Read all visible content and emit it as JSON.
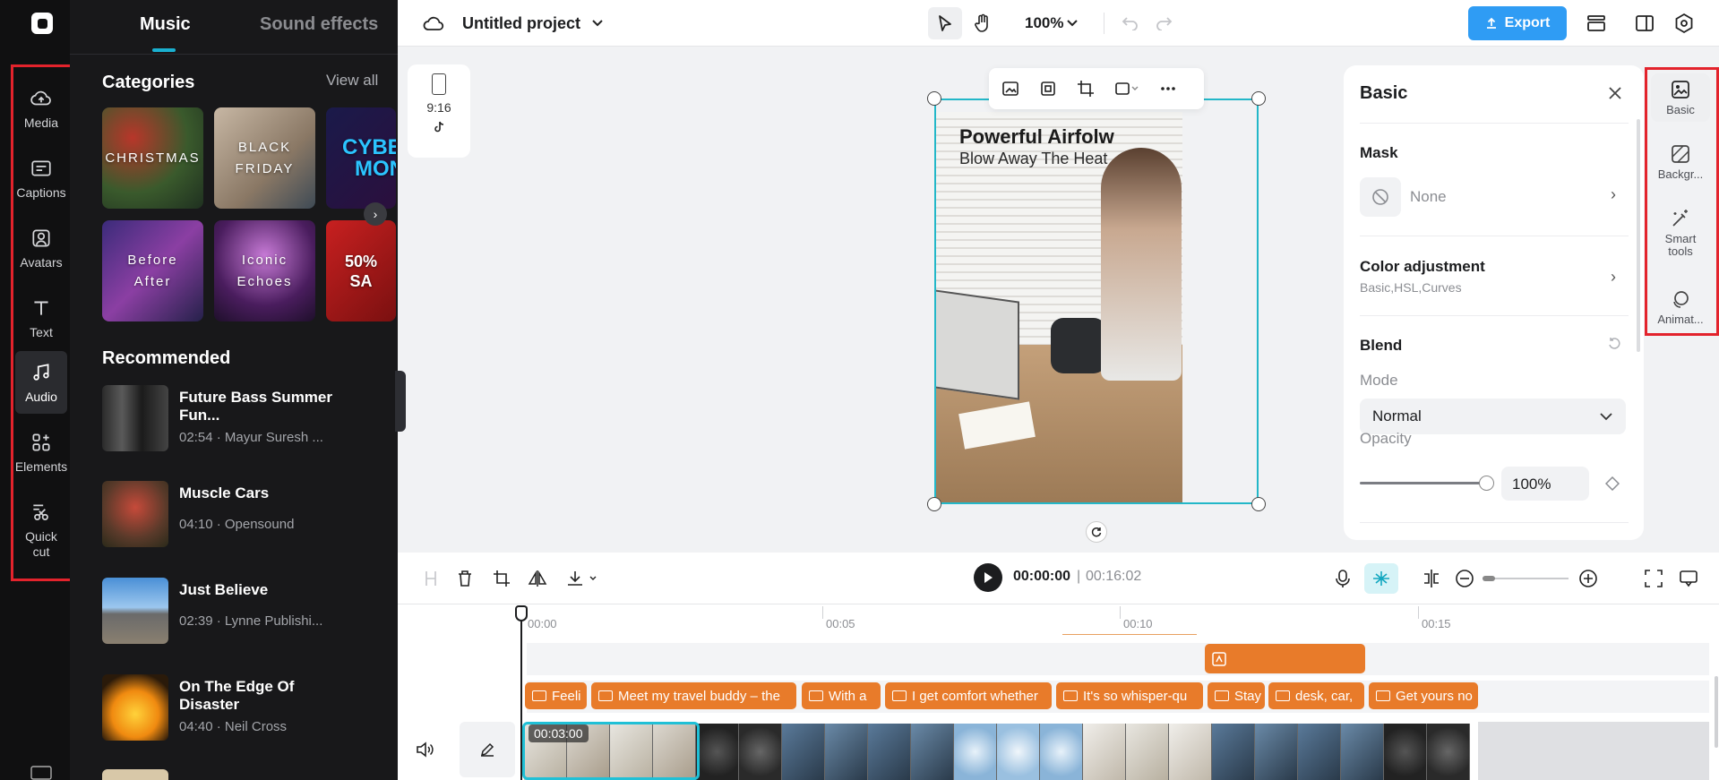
{
  "sidebar": {
    "items": [
      {
        "label": "Media",
        "icon": "cloud-upload-icon"
      },
      {
        "label": "Captions",
        "icon": "captions-icon"
      },
      {
        "label": "Avatars",
        "icon": "avatar-icon"
      },
      {
        "label": "Text",
        "icon": "text-icon"
      },
      {
        "label": "Audio",
        "icon": "music-note-icon"
      },
      {
        "label": "Elements",
        "icon": "elements-icon"
      },
      {
        "label": "Quick cut",
        "icon": "scissors-icon"
      }
    ],
    "active": "Audio"
  },
  "library": {
    "tabs": [
      "Music",
      "Sound effects"
    ],
    "categories_title": "Categories",
    "view_all": "View all",
    "categories": [
      {
        "label": "CHRISTMAS"
      },
      {
        "label": "BLACK\nFRIDAY"
      },
      {
        "label": "CYBER\nMON"
      },
      {
        "label": "Before\nAfter"
      },
      {
        "label": "Iconic\nEchoes"
      },
      {
        "label": "50%\nSA"
      }
    ],
    "recommended_title": "Recommended",
    "songs": [
      {
        "name": "Future Bass Summer Fun...",
        "meta": "02:54 · Mayur Suresh ..."
      },
      {
        "name": "Muscle Cars",
        "meta": "04:10 · Opensound"
      },
      {
        "name": "Just Believe",
        "meta": "02:39 · Lynne Publishi..."
      },
      {
        "name": "On The Edge Of Disaster",
        "meta": "04:40 · Neil Cross"
      }
    ]
  },
  "header": {
    "project_name": "Untitled project",
    "zoom": "100%",
    "export_label": "Export"
  },
  "canvas": {
    "ratio_label": "9:16",
    "headline": "Powerful Airfolw",
    "subline": "Blow Away The Heat"
  },
  "props": {
    "title": "Basic",
    "mask_label": "Mask",
    "mask_value": "None",
    "color_adj_label": "Color adjustment",
    "color_adj_sub": "Basic,HSL,Curves",
    "blend_label": "Blend",
    "mode_label": "Mode",
    "mode_value": "Normal",
    "opacity_label": "Opacity",
    "opacity_value": "100%",
    "opacity_level": 1.0
  },
  "right_tools": [
    {
      "label": "Basic",
      "icon": "image-adjust-icon"
    },
    {
      "label": "Backgr...",
      "icon": "background-icon"
    },
    {
      "label": "Smart tools",
      "icon": "magic-wand-icon"
    },
    {
      "label": "Animat...",
      "icon": "animation-icon"
    }
  ],
  "timeline": {
    "current_time": "00:00:00",
    "separator": "|",
    "total_time": "00:16:02",
    "ruler": [
      "00:00",
      "00:05",
      "00:10",
      "00:15"
    ],
    "clip_time": "00:03:00",
    "captions": [
      "Feeli",
      "Meet my travel buddy – the",
      "With a",
      "I get comfort whether",
      "It's so whisper-qu",
      "Stay",
      "desk, car,",
      "Get yours no"
    ]
  },
  "colors": {
    "accent": "#2f9cf4",
    "selection": "#23b7c8",
    "caption_clip": "#e87b2a",
    "highlight_box": "#e3232c"
  }
}
